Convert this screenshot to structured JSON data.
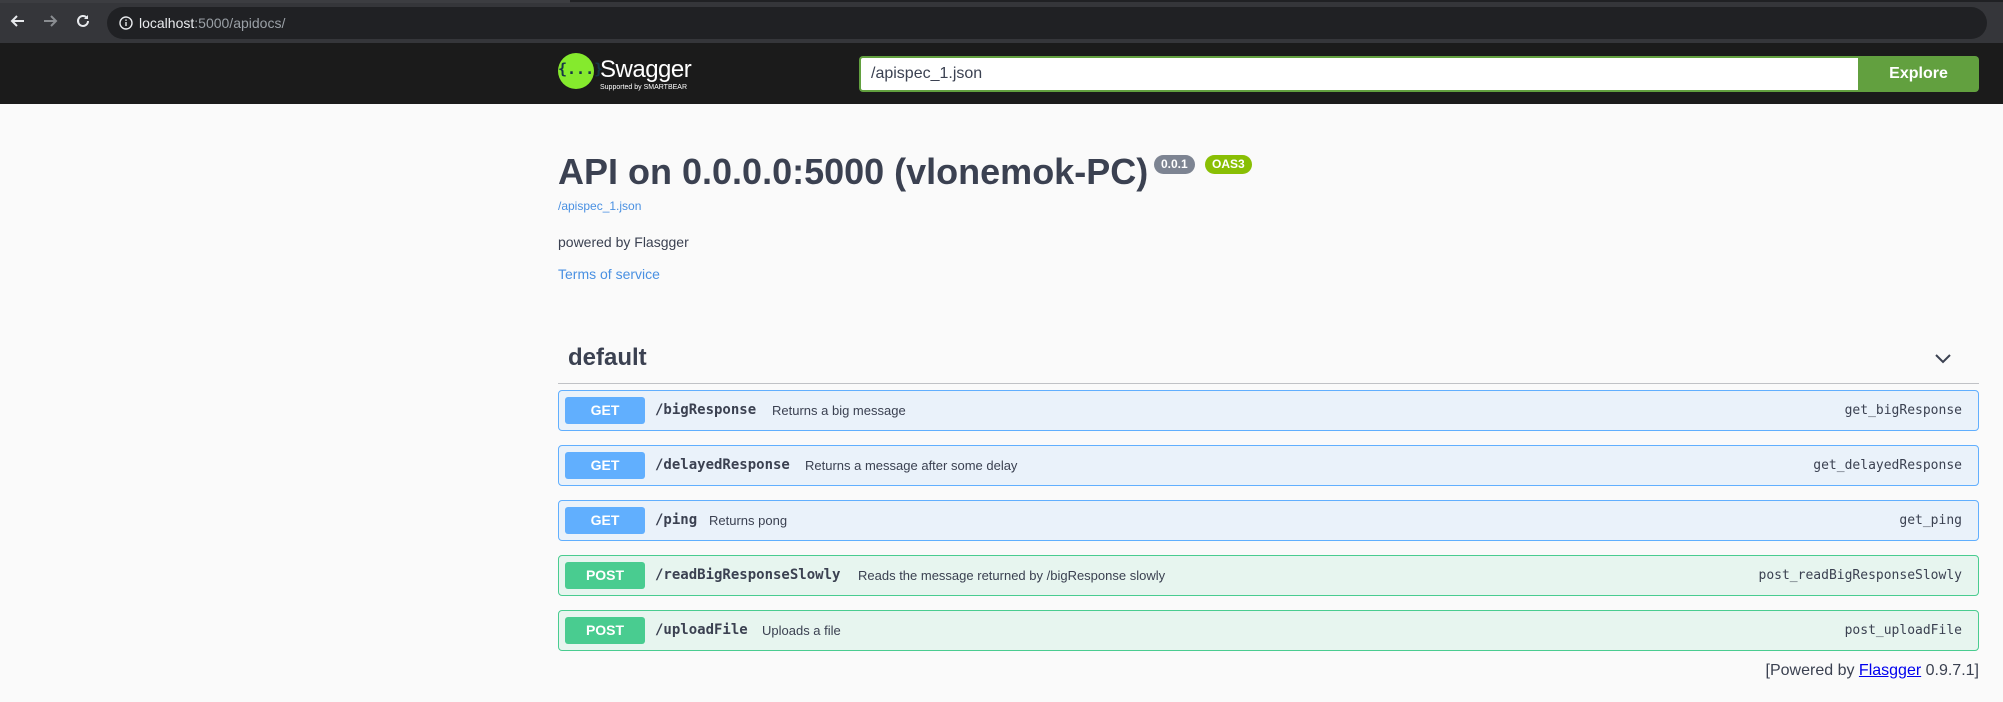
{
  "browser": {
    "url_host": "localhost",
    "url_path": ":5000/apidocs/"
  },
  "topbar": {
    "logo_text": "Swagger",
    "logo_sub": "Supported by SMARTBEAR",
    "logo_glyph": "{...}",
    "spec_input_value": "/apispec_1.json",
    "explore_label": "Explore",
    "colors": {
      "accent": "#62a03f",
      "bg": "#1b1b1b",
      "logo": "#85ea2d"
    }
  },
  "info": {
    "title": "API on 0.0.0.0:5000 (vlonemok-PC)",
    "version_badge": "0.0.1",
    "oas_badge": "OAS3",
    "spec_link": "/apispec_1.json",
    "description": "powered by Flasgger",
    "terms_link": "Terms of service"
  },
  "tag": {
    "name": "default",
    "toggle_icon": "chevron-down-icon"
  },
  "operations": [
    {
      "method": "GET",
      "path": "/bigResponse",
      "summary": "Returns a big message",
      "operation_id": "get_bigResponse",
      "color": "#61affe"
    },
    {
      "method": "GET",
      "path": "/delayedResponse",
      "summary": "Returns a message after some delay",
      "operation_id": "get_delayedResponse",
      "color": "#61affe"
    },
    {
      "method": "GET",
      "path": "/ping",
      "summary": "Returns pong",
      "operation_id": "get_ping",
      "color": "#61affe"
    },
    {
      "method": "POST",
      "path": "/readBigResponseSlowly",
      "summary": "Reads the message returned by /bigResponse slowly",
      "operation_id": "post_readBigResponseSlowly",
      "color": "#49cc90"
    },
    {
      "method": "POST",
      "path": "/uploadFile",
      "summary": "Uploads a file",
      "operation_id": "post_uploadFile",
      "color": "#49cc90"
    }
  ],
  "footer": {
    "prefix": "[Powered by ",
    "link": "Flasgger",
    "suffix": " 0.9.7.1]"
  }
}
